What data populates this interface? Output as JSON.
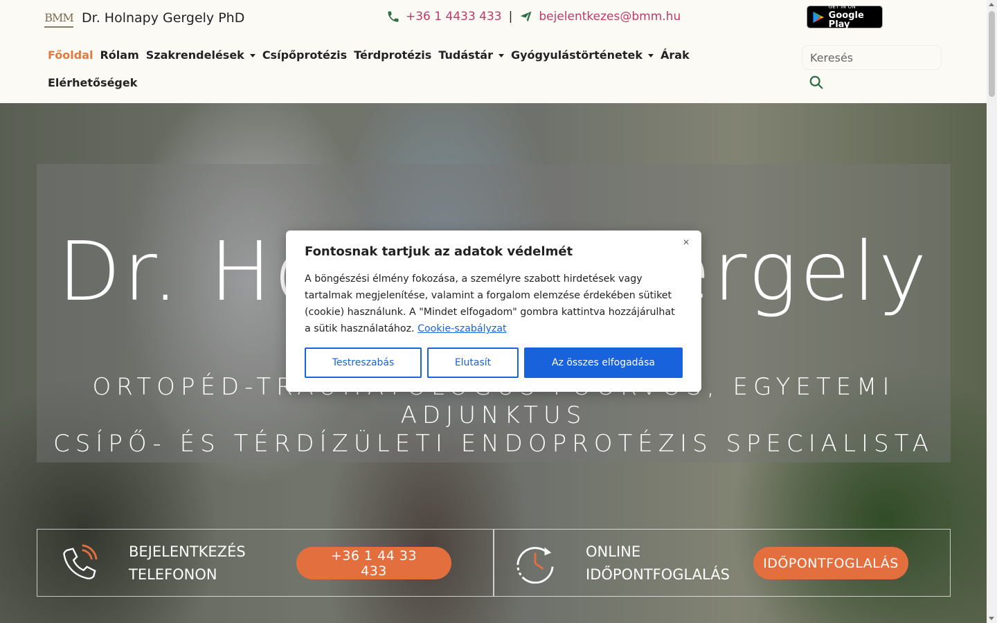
{
  "header": {
    "brand_logo": "BMM",
    "brand_title": "Dr. Holnapy Gergely PhD",
    "phone": "+36 1 4433 433",
    "separator": "|",
    "email": "bejelentkezes@bmm.hu",
    "gplay_small": "GET IN ON",
    "gplay_big": "Google Play"
  },
  "nav": {
    "items": [
      {
        "label": "Főoldal"
      },
      {
        "label": "Rólam"
      },
      {
        "label": "Szakrendelések"
      },
      {
        "label": "Csípőprotézis"
      },
      {
        "label": "Térdprotézis"
      },
      {
        "label": "Tudástár"
      },
      {
        "label": "Gyógyulástörténetek"
      },
      {
        "label": "Árak"
      },
      {
        "label": "Elérhetőségek"
      }
    ],
    "search_placeholder": "Keresés"
  },
  "hero": {
    "title": "Dr. Holnapy Gergely",
    "subtitle_line1": "ORTOPÉD-TRAUMATOLÓGUS FŐORVOS, EGYETEMI ADJUNKTUS",
    "subtitle_line2": "CSÍPŐ- ÉS TÉRDÍZÜLETI ENDOPROTÉZIS SPECIALISTA"
  },
  "cta": {
    "phone_label_1": "BEJELENTKEZÉS",
    "phone_label_2": "TELEFONON",
    "phone_button": "+36 1 44 33 433",
    "online_label_1": "ONLINE",
    "online_label_2": "IDŐPONTFOGLALÁS",
    "online_button": "IDŐPONTFOGLALÁS"
  },
  "cookie": {
    "title": "Fontosnak tartjuk az adatok védelmét",
    "text": "A böngészési élmény fokozása, a személyre szabott hirdetések vagy tartalmak megjelenítése, valamint a forgalom elemzése érdekében sütiket (cookie) használunk. A \"Mindet elfogadom\" gombra kattintva hozzájárulhat a sütik használatához.",
    "link": "Cookie-szabályzat",
    "btn_customize": "Testreszabás",
    "btn_reject": "Elutasít",
    "btn_accept": "Az összes elfogadása",
    "close": "×"
  },
  "colors": {
    "accent": "#e27a3f",
    "link": "#c0396b",
    "cookie_blue": "#1863dc",
    "cta_orange": "#e36f3f"
  }
}
